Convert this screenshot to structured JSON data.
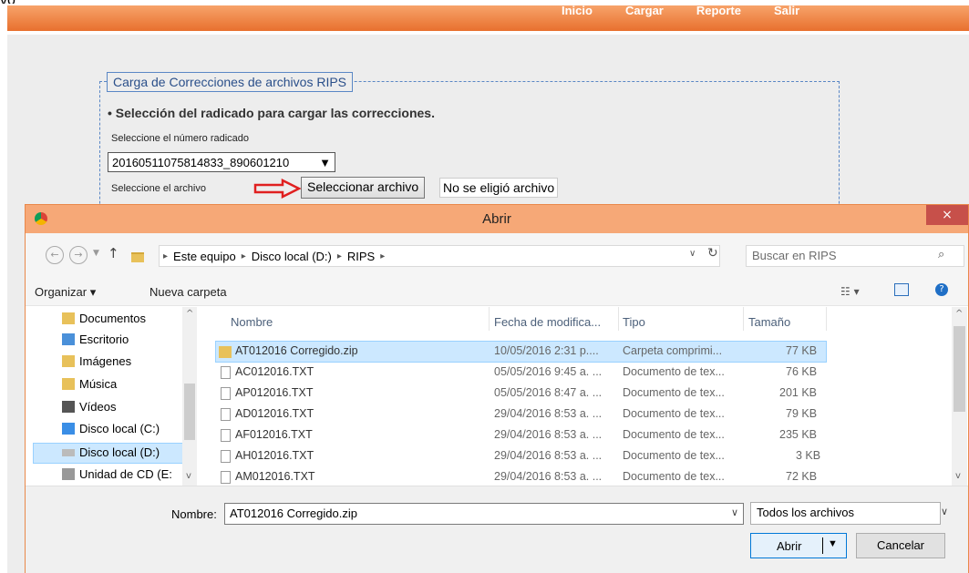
{
  "page": {
    "top_fragment": "vo",
    "nav": [
      "Inicio",
      "Cargar",
      "Reporte",
      "Salir"
    ],
    "legend": "Carga de Correcciones de archivos RIPS",
    "bullet": "• Selección del radicado para cargar las correcciones.",
    "label_radicado": "Seleccione el número radicado",
    "radicado_value": "20160511075814833_890601210",
    "label_archivo": "Seleccione el archivo",
    "file_button": "Seleccionar archivo",
    "file_status": "No se eligió archivo"
  },
  "dialog": {
    "title": "Abrir",
    "close_glyph": "×",
    "breadcrumb": [
      "Este equipo",
      "Disco local (D:)",
      "RIPS"
    ],
    "search_placeholder": "Buscar en RIPS",
    "toolbar": {
      "organize": "Organizar ▾",
      "new_folder": "Nueva carpeta"
    },
    "nav_items": [
      {
        "label": "Documentos",
        "icon": "documents-folder-icon"
      },
      {
        "label": "Escritorio",
        "icon": "desktop-folder-icon"
      },
      {
        "label": "Imágenes",
        "icon": "pictures-folder-icon"
      },
      {
        "label": "Música",
        "icon": "music-folder-icon"
      },
      {
        "label": "Vídeos",
        "icon": "videos-folder-icon"
      },
      {
        "label": "Disco local (C:)",
        "icon": "drive-c-icon"
      },
      {
        "label": "Disco local (D:)",
        "icon": "drive-d-icon"
      },
      {
        "label": "Unidad de CD (E:",
        "icon": "cd-drive-icon"
      }
    ],
    "columns": [
      "Nombre",
      "Fecha de modifica...",
      "Tipo",
      "Tamaño"
    ],
    "files": [
      {
        "name": "AT012016 Corregido.zip",
        "date": "10/05/2016 2:31 p....",
        "type": "Carpeta comprimi...",
        "size": "77 KB",
        "icon": "zip-folder-icon"
      },
      {
        "name": "AC012016.TXT",
        "date": "05/05/2016 9:45 a. ...",
        "type": "Documento de tex...",
        "size": "76 KB",
        "icon": "text-file-icon"
      },
      {
        "name": "AP012016.TXT",
        "date": "05/05/2016 8:47 a. ...",
        "type": "Documento de tex...",
        "size": "201 KB",
        "icon": "text-file-icon"
      },
      {
        "name": "AD012016.TXT",
        "date": "29/04/2016 8:53 a. ...",
        "type": "Documento de tex...",
        "size": "79 KB",
        "icon": "text-file-icon"
      },
      {
        "name": "AF012016.TXT",
        "date": "29/04/2016 8:53 a. ...",
        "type": "Documento de tex...",
        "size": "235 KB",
        "icon": "text-file-icon"
      },
      {
        "name": "AH012016.TXT",
        "date": "29/04/2016 8:53 a. ...",
        "type": "Documento de tex...",
        "size": "3 KB",
        "icon": "text-file-icon"
      },
      {
        "name": "AM012016.TXT",
        "date": "29/04/2016 8:53 a. ...",
        "type": "Documento de tex...",
        "size": "72 KB",
        "icon": "text-file-icon"
      }
    ],
    "filename_label": "Nombre:",
    "filename_value": "AT012016 Corregido.zip",
    "filter_value": "Todos los archivos",
    "open_button": "Abrir",
    "cancel_button": "Cancelar"
  }
}
